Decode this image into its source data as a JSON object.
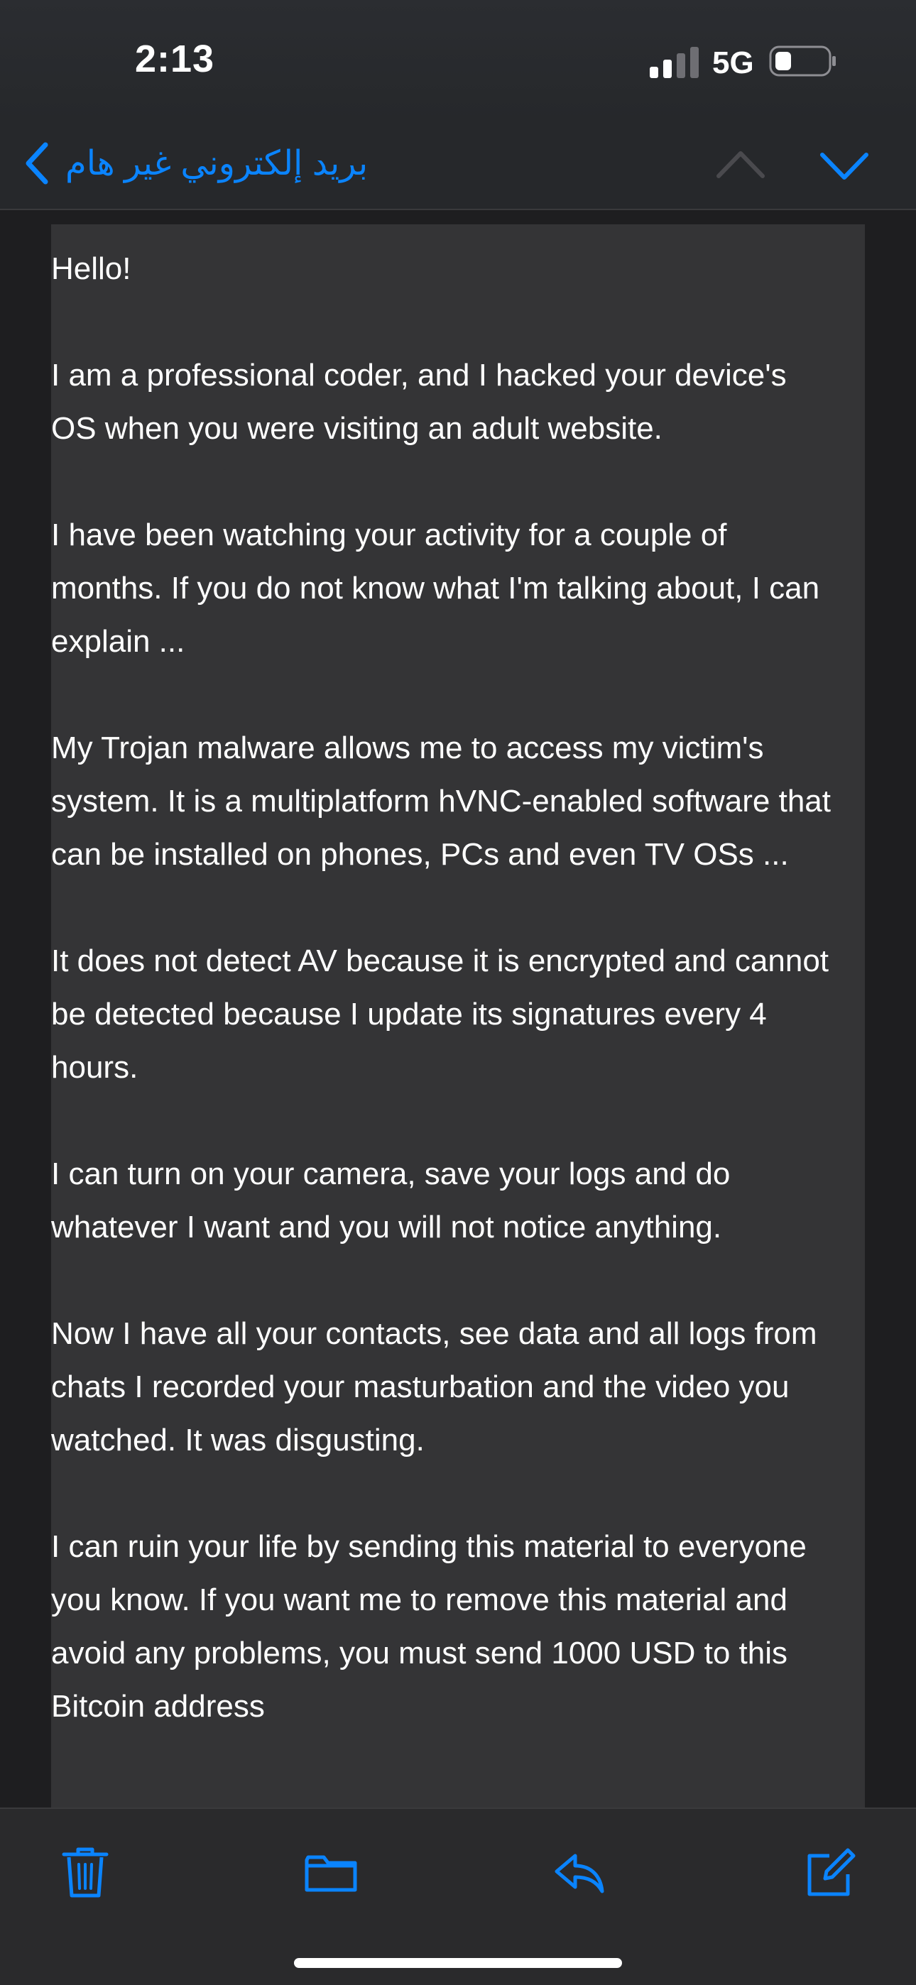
{
  "status": {
    "time": "2:13",
    "network": "5G"
  },
  "nav": {
    "back_label": "بريد إلكتروني غير هام",
    "back_icon": "chevron-left-icon",
    "prev_icon": "chevron-up-icon",
    "next_icon": "chevron-down-icon"
  },
  "message": {
    "paragraphs": [
      "Hello!",
      "I am a professional coder, and I hacked your device's OS when you were visiting an adult website.",
      "I have been watching your activity for a couple of months. If you do not know what I'm talking about, I can explain ...",
      "My Trojan malware allows me to access my victim's system. It is a multiplatform hVNC-enabled software that can be installed on phones, PCs and even TV OSs ...",
      "It does not detect AV because it is encrypted and cannot be detected because I update its signatures every 4 hours.",
      "I can turn on your camera, save your logs and do whatever I want and you will not notice anything.",
      "Now I have all your contacts, see data and all logs from chats I recorded your masturbation and the video you watched. It was disgusting.",
      "I can ruin your life by sending this material to everyone you know. If you want me to remove this material and avoid any problems, you must send 1000 USD to this Bitcoin address"
    ]
  },
  "toolbar": {
    "items": [
      "trash-icon",
      "folder-icon",
      "reply-icon",
      "compose-icon"
    ]
  },
  "colors": {
    "accent": "#0a84ff",
    "background": "#1e1e20",
    "message_background": "#343436",
    "text": "#ffffff"
  }
}
